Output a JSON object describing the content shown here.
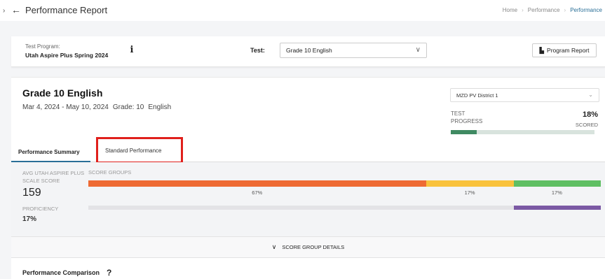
{
  "header": {
    "back_icon": "←",
    "title": "Performance Report",
    "breadcrumbs": [
      "Home",
      "Performance",
      "Performance"
    ]
  },
  "program_bar": {
    "test_program_label": "Test Program:",
    "test_program_value": "Utah Aspire Plus Spring 2024",
    "info_icon": "i",
    "test_label": "Test:",
    "test_value": "Grade 10 English",
    "chevron": "∨",
    "report_button": "Program Report",
    "report_icon": "▙"
  },
  "card": {
    "title": "Grade 10 English",
    "dates": "Mar 4, 2024 - May 10, 2024",
    "grade": "Grade: 10",
    "subject": "English",
    "district_select": "MZD PV District 1",
    "district_chevron": "⌄",
    "test_progress_label": "TEST PROGRESS",
    "test_progress_value": "18%",
    "scored_label": "SCORED",
    "test_progress_fraction": 0.18
  },
  "tabs": {
    "summary": "Performance Summary",
    "standard": "Standard Performance"
  },
  "summary": {
    "avg_label": "AVG UTAH ASPIRE PLUS SCALE SCORE",
    "avg_value": "159",
    "proficiency_label": "PROFICIENCY",
    "proficiency_value": "17%",
    "proficiency_fraction": 0.17,
    "score_groups_label": "SCORE GROUPS",
    "groups": [
      {
        "pct": "67%",
        "value": 0.66,
        "color": "#ee6a33"
      },
      {
        "pct": "17%",
        "value": 0.17,
        "color": "#f9c23c"
      },
      {
        "pct": "17%",
        "value": 0.17,
        "color": "#5fbf63"
      }
    ]
  },
  "details_button": "SCORE GROUP DETAILS",
  "details_chevron": "∨",
  "comparison": {
    "title": "Performance Comparison",
    "help_icon": "?"
  }
}
